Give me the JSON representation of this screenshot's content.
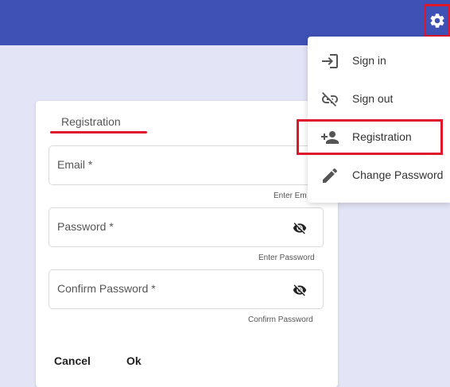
{
  "header": {
    "settings_icon": "gear-icon",
    "background": "#3f51b5"
  },
  "form": {
    "tab_label": "Registration",
    "email": {
      "label": "Email *",
      "hint": "Enter Em"
    },
    "password": {
      "label": "Password *",
      "hint": "Enter Password",
      "icon": "eye-off-icon"
    },
    "confirm": {
      "label": "Confirm Password *",
      "hint": "Confirm Password",
      "icon": "eye-off-icon"
    },
    "cancel_label": "Cancel",
    "ok_label": "Ok"
  },
  "menu": {
    "items": [
      {
        "label": "Sign in",
        "icon": "sign-in-icon"
      },
      {
        "label": "Sign out",
        "icon": "link-off-icon"
      },
      {
        "label": "Registration",
        "icon": "person-add-icon"
      },
      {
        "label": "Change Password",
        "icon": "pencil-icon"
      }
    ]
  },
  "colors": {
    "accent": "#e0162b",
    "page_bg": "#e4e4f7"
  }
}
